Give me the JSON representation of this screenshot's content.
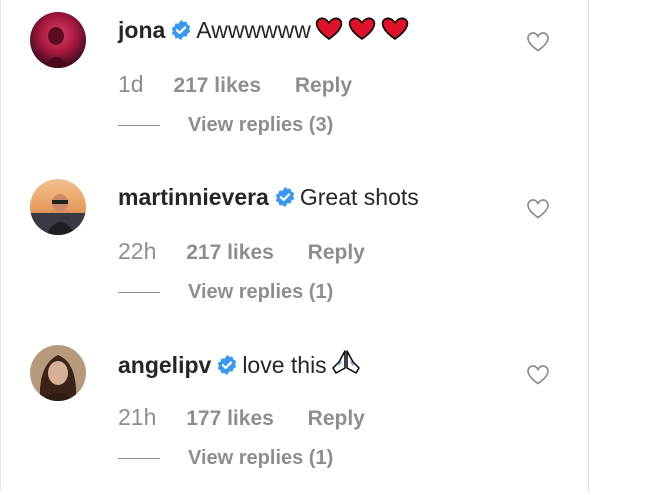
{
  "comments": [
    {
      "username": "jona",
      "text": "Awwwwww",
      "emoji": "heart-emoji-x3",
      "time": "1d",
      "likes": "217 likes",
      "reply": "Reply",
      "view_replies": "View replies (3)"
    },
    {
      "username": "martinnievera",
      "text": "Great shots",
      "time": "22h",
      "likes": "217 likes",
      "reply": "Reply",
      "view_replies": "View replies (1)"
    },
    {
      "username": "angelipv",
      "text": "love this",
      "emoji": "folded-hands-emoji",
      "time": "21h",
      "likes": "177 likes",
      "reply": "Reply",
      "view_replies": "View replies (1)"
    }
  ],
  "colors": {
    "text": "#262626",
    "meta": "#8e8e8e",
    "verified": "#3897f0",
    "heart_emoji": "#e0102b",
    "border": "#dbdbdb"
  }
}
